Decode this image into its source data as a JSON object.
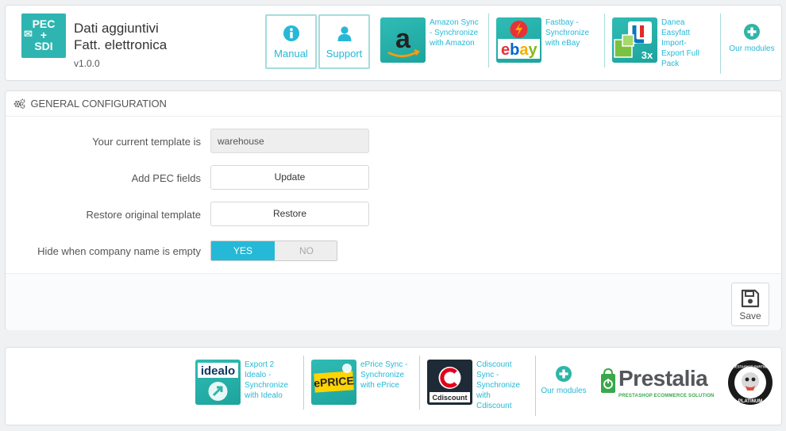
{
  "header": {
    "logo_text": [
      "PEC",
      "+",
      "SDI"
    ],
    "title_line1": "Dati aggiuntivi",
    "title_line2": "Fatt. elettronica",
    "version": "v1.0.0",
    "manual_label": "Manual",
    "support_label": "Support",
    "promos": [
      {
        "text": "Amazon Sync - Synchronize with Amazon",
        "lines": [
          "Amazon Sync",
          "- Synchronize",
          "with Amazon"
        ],
        "icon": "amazon-icon"
      },
      {
        "text": "Fastbay - Synchronize with eBay",
        "lines": [
          "Fastbay -",
          "Synchronize",
          "with eBay"
        ],
        "icon": "ebay-icon"
      },
      {
        "text": "Danea Easyfatt Import-Export Full Pack",
        "lines": [
          "Danea",
          "Easyfatt",
          "Import-",
          "Export Full",
          "Pack"
        ],
        "icon": "danea-icon"
      }
    ],
    "our_modules": "Our modules",
    "accent_color": "#25b9d7"
  },
  "config": {
    "heading": "GENERAL CONFIGURATION",
    "template_label": "Your current template is",
    "template_value": "warehouse",
    "pec_label": "Add PEC fields",
    "pec_button": "Update",
    "restore_label": "Restore original template",
    "restore_button": "Restore",
    "hide_label": "Hide when company name is empty",
    "yes": "YES",
    "no": "NO",
    "hide_selected": "YES",
    "save": "Save"
  },
  "footer": {
    "promos": [
      {
        "text": "Export 2 Idealo - Synchronize with Idealo",
        "lines": [
          "Export 2",
          "Idealo -",
          "Synchronize",
          "with Idealo"
        ],
        "icon": "idealo-icon",
        "badge": "idealo"
      },
      {
        "text": "ePrice Sync - Synchronize with ePrice",
        "lines": [
          "ePrice Sync -",
          "Synchronize",
          "with ePrice"
        ],
        "icon": "eprice-icon",
        "badge": "ePRICE"
      },
      {
        "text": "Cdiscount Sync - Synchronize with Cdiscount",
        "lines": [
          "Cdiscount",
          "Sync -",
          "Synchronize",
          "with",
          "Cdiscount"
        ],
        "icon": "cdiscount-icon",
        "badge": "Cdiscount"
      }
    ],
    "our_modules": "Our modules",
    "brand": "Prestalia",
    "brand_tagline": "PRESTASHOP ECOMMERCE SOLUTION",
    "badge_top": "PRESTASHOP PARTNER",
    "badge_bottom": "PLATINUM"
  }
}
